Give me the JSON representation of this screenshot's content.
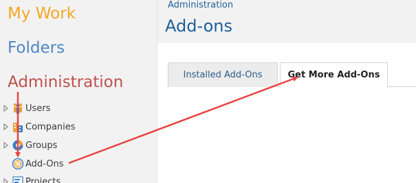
{
  "sidebar": {
    "nav": [
      {
        "label": "My Work",
        "color": "#f5a623"
      },
      {
        "label": "Folders",
        "color": "#4f86c6"
      },
      {
        "label": "Administration",
        "color": "#c0504d"
      }
    ],
    "tree": [
      {
        "label": "Users",
        "icon": "users-icon"
      },
      {
        "label": "Companies",
        "icon": "companies-icon"
      },
      {
        "label": "Groups",
        "icon": "groups-icon"
      },
      {
        "label": "Add-Ons",
        "icon": "add-ons-icon"
      },
      {
        "label": "Projects",
        "icon": "projects-icon"
      }
    ]
  },
  "header": {
    "breadcrumb": "Administration",
    "title": "Add-ons",
    "color": "#1f5f99"
  },
  "tabs": [
    {
      "label": "Installed Add-Ons",
      "active": false
    },
    {
      "label": "Get More Add-Ons",
      "active": true
    }
  ],
  "colors": {
    "annotation": "#e84343",
    "tab_text": "#2b5d8a",
    "tab_active_text": "#222222"
  }
}
